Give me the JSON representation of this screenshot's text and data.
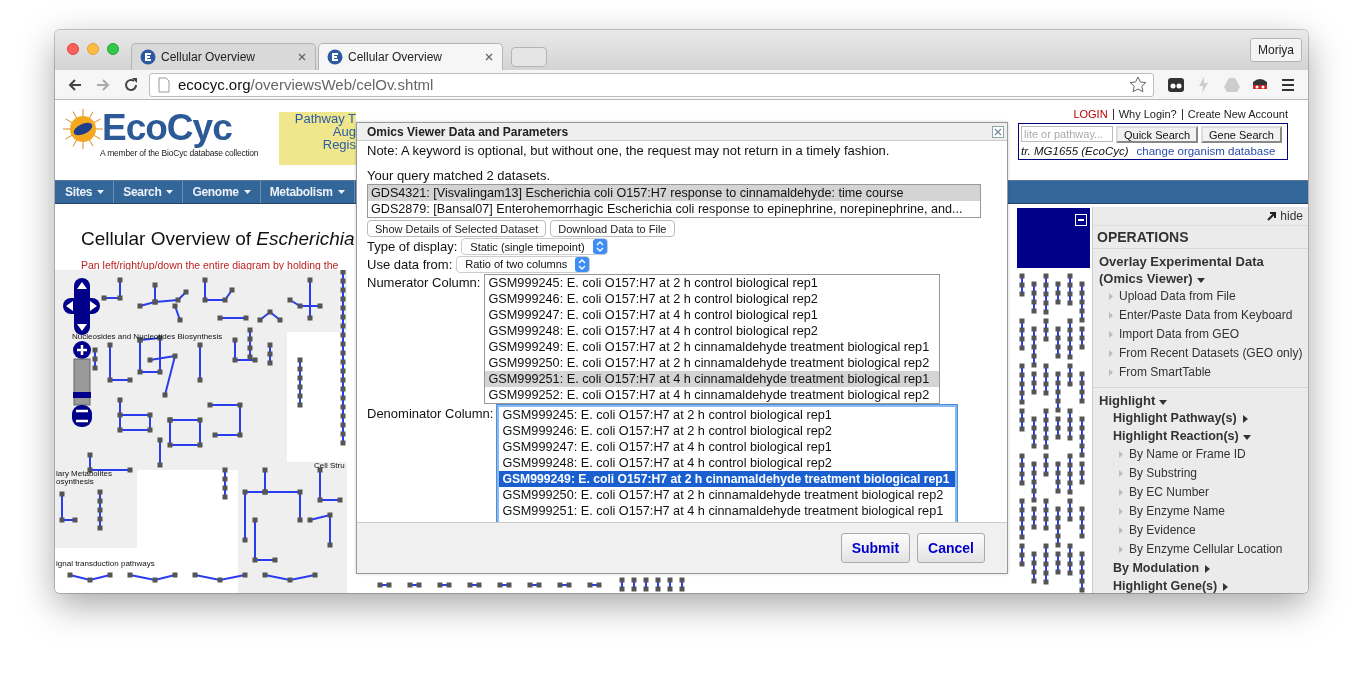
{
  "browser": {
    "tabs": [
      {
        "title": "Cellular Overview",
        "selected": false
      },
      {
        "title": "Cellular Overview",
        "selected": true
      }
    ],
    "profile": "Moriya",
    "url": {
      "host": "ecocyc.org",
      "path": "/overviewsWeb/celOv.shtml"
    }
  },
  "header": {
    "logo": "EcoCyc",
    "tagline": "A member of the BioCyc database collection",
    "ad_lines": [
      "Pathway T",
      "Aug",
      "Regis"
    ],
    "account_links": [
      "LOGIN",
      "Why Login?",
      "Create New Account"
    ],
    "search_placeholder": "lite or pathway...",
    "search_buttons": [
      "Quick Search",
      "Gene Search"
    ],
    "organism": "tr. MG1655 (EcoCyc)",
    "organism_link": "change organism database"
  },
  "nav": [
    "Sites",
    "Search",
    "Genome",
    "Metabolism"
  ],
  "title": "Cellular Overview of *Escherichia*",
  "instruction": "Pan left/right/up/down the entire diagram by holding the",
  "diagram": {
    "zoom": {
      "level": 0.15
    },
    "labels": [
      "Nucleosides and Nucleotides Biosynthesis",
      "Cell Stru",
      "lary Metabolites",
      "osynthesis",
      "ignal transduction pathways"
    ]
  },
  "operations": {
    "hide": "hide",
    "heading": "OPERATIONS",
    "sections": [
      {
        "label": "Overlay Experimental Data (Omics Viewer)",
        "expanded": true,
        "children": [
          {
            "label": "Upload Data from File"
          },
          {
            "label": "Enter/Paste Data from Keyboard"
          },
          {
            "label": "Import Data from GEO"
          },
          {
            "label": "From Recent Datasets (GEO only)"
          },
          {
            "label": "From SmartTable"
          }
        ]
      },
      {
        "label": "Highlight",
        "expanded": true,
        "children": [
          {
            "label": "Highlight Pathway(s)",
            "expanded": false
          },
          {
            "label": "Highlight Reaction(s)",
            "expanded": true,
            "children": [
              {
                "label": "By Name or Frame ID"
              },
              {
                "label": "By Substring"
              },
              {
                "label": "By EC Number"
              },
              {
                "label": "By Enzyme Name"
              },
              {
                "label": "By Evidence"
              },
              {
                "label": "By Enzyme Cellular Location"
              }
            ]
          },
          {
            "label": "By Modulation",
            "expanded": false
          },
          {
            "label": "Highlight Gene(s)",
            "expanded": false
          }
        ]
      }
    ]
  },
  "dialog": {
    "title": "Omics Viewer Data and Parameters",
    "note": "Note: A keyword is optional, but without one, the request may not return in a timely fashion.",
    "match": "Your query matched 2 datasets.",
    "datasets": [
      {
        "text": "GDS4321: [Visvalingam13] Escherichia coli O157:H7 response to cinnamaldehyde: time course",
        "selected": true
      },
      {
        "text": "GDS2879: [Bansal07] Enterohemorrhagic Escherichia coli response to epinephrine, norepinephrine, and...",
        "selected": false
      }
    ],
    "actions": [
      "Show Details of Selected Dataset",
      "Download Data to File"
    ],
    "display_type": {
      "label": "Type of display:",
      "value": "Static (single timepoint)"
    },
    "data_from": {
      "label": "Use data from:",
      "value": "Ratio of two columns"
    },
    "numerator": {
      "label": "Numerator Column:",
      "focused": false,
      "rows": [
        {
          "text": "GSM999245: E. coli O157:H7 at 2 h control biological rep1",
          "selected": false
        },
        {
          "text": "GSM999246: E. coli O157:H7 at 2 h control biological rep2",
          "selected": false
        },
        {
          "text": "GSM999247: E. coli O157:H7 at 4 h control biological rep1",
          "selected": false
        },
        {
          "text": "GSM999248: E. coli O157:H7 at 4 h control biological rep2",
          "selected": false
        },
        {
          "text": "GSM999249: E. coli O157:H7 at 2 h cinnamaldehyde treatment biological rep1",
          "selected": false
        },
        {
          "text": "GSM999250: E. coli O157:H7 at 2 h cinnamaldehyde treatment biological rep2",
          "selected": false
        },
        {
          "text": "GSM999251: E. coli O157:H7 at 4 h cinnamaldehyde treatment biological rep1",
          "selected": true
        },
        {
          "text": "GSM999252: E. coli O157:H7 at 4 h cinnamaldehyde treatment biological rep2",
          "selected": false
        }
      ]
    },
    "denominator": {
      "label": "Denominator Column:",
      "focused": true,
      "rows": [
        {
          "text": "GSM999245: E. coli O157:H7 at 2 h control biological rep1",
          "selected": false
        },
        {
          "text": "GSM999246: E. coli O157:H7 at 2 h control biological rep2",
          "selected": false
        },
        {
          "text": "GSM999247: E. coli O157:H7 at 4 h control biological rep1",
          "selected": false
        },
        {
          "text": "GSM999248: E. coli O157:H7 at 4 h control biological rep2",
          "selected": false
        },
        {
          "text": "GSM999249: E. coli O157:H7 at 2 h cinnamaldehyde treatment biological rep1",
          "selected": true
        },
        {
          "text": "GSM999250: E. coli O157:H7 at 2 h cinnamaldehyde treatment biological rep2",
          "selected": false
        },
        {
          "text": "GSM999251: E. coli O157:H7 at 4 h cinnamaldehyde treatment biological rep1",
          "selected": false
        }
      ]
    },
    "buttons": [
      "Submit",
      "Cancel"
    ]
  }
}
